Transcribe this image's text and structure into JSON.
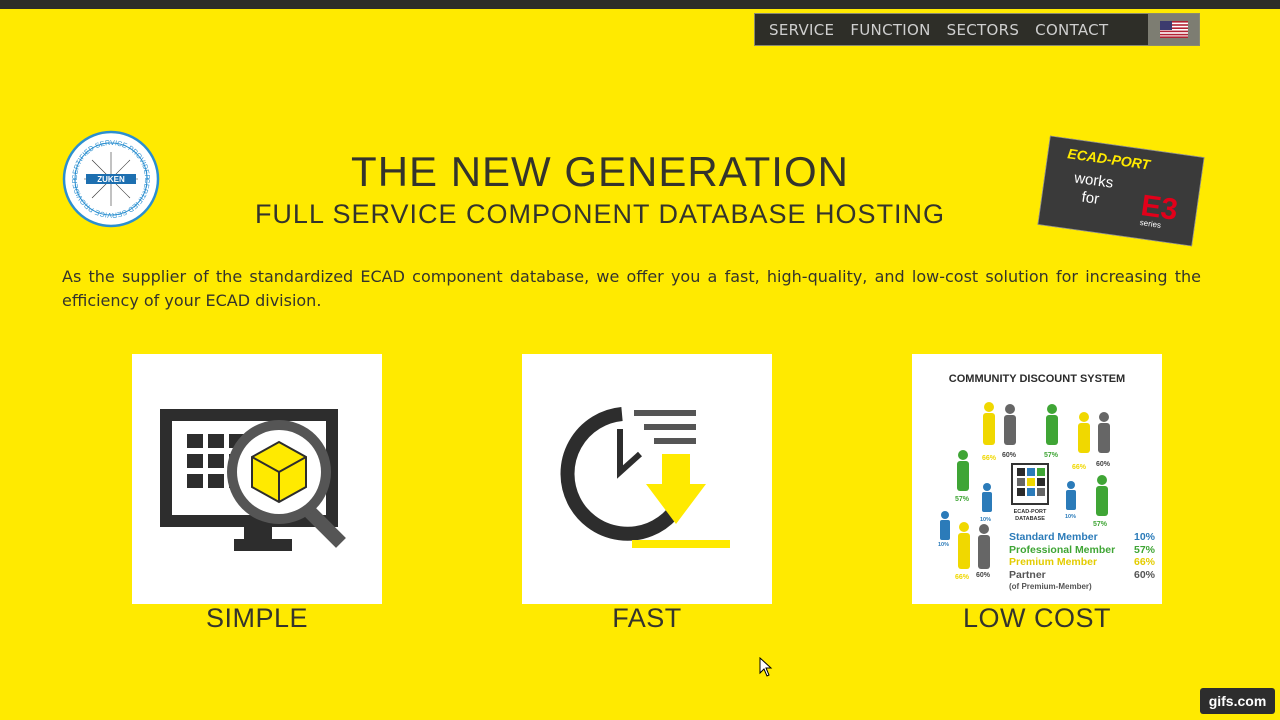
{
  "nav": {
    "items": [
      "SERVICE",
      "FUNCTION",
      "SECTORS",
      "CONTACT"
    ],
    "language_icon": "us-flag-icon"
  },
  "hero": {
    "title": "THE NEW GENERATION",
    "subtitle": "FULL SERVICE COMPONENT DATABASE HOSTING",
    "intro": "As the supplier of the standardized ECAD component database, we offer you a fast, high-quality, and low-cost solution for increasing the efficiency of your ECAD division."
  },
  "cert_badge": {
    "text_ring": "CERTIFIED SERVICE PROVIDER",
    "brand": "ZUKEN"
  },
  "ecad_badge": {
    "brand": "ECAD-PORT",
    "line1": "works",
    "line2": "for",
    "product": "E3",
    "product_sub": "series"
  },
  "features": [
    {
      "label": "SIMPLE",
      "icon": "monitor-search-cube-icon"
    },
    {
      "label": "FAST",
      "icon": "clock-download-icon"
    },
    {
      "label": "LOW COST",
      "icon": "community-discount-infographic"
    }
  ],
  "discount": {
    "title": "COMMUNITY  DISCOUNT SYSTEM",
    "center_label_1": "ECAD-PORT",
    "center_label_2": "DATABASE",
    "figure_percents": [
      "66%",
      "60%",
      "57%",
      "66%",
      "60%",
      "57%",
      "10%",
      "10%",
      "57%",
      "10%",
      "66%",
      "60%"
    ],
    "members": [
      {
        "name": "Standard Member",
        "pct": "10%",
        "color": "#2b7bb9"
      },
      {
        "name": "Professional Member",
        "pct": "57%",
        "color": "#3fa535"
      },
      {
        "name": "Premium Member",
        "pct": "66%",
        "color": "#f0d800"
      },
      {
        "name": "Partner",
        "pct": "60%",
        "color": "#555555"
      }
    ],
    "partner_note": "(of Premium-Member)"
  },
  "colors": {
    "background": "#ffea00",
    "nav_bg": "#2e2e28",
    "text": "#34342c"
  },
  "watermark": "gifs.com"
}
